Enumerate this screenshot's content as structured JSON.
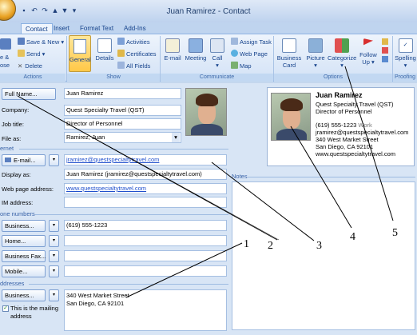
{
  "window": {
    "title": "Juan Ramirez - Contact"
  },
  "qat": {
    "save_icon": "save-icon",
    "undo_icon": "undo-icon",
    "redo_icon": "redo-icon",
    "up_glyph": "▲",
    "down_glyph": "▼",
    "more_glyph": "▾"
  },
  "tabs": [
    {
      "label": "Contact"
    },
    {
      "label": "Insert"
    },
    {
      "label": "Format Text"
    },
    {
      "label": "Add-Ins"
    }
  ],
  "ribbon": {
    "actions": {
      "label": "Actions",
      "save_close_line1": "e &",
      "save_close_line2": "ose",
      "save_new": "Save & New ▾",
      "send": "Send ▾",
      "delete": "Delete"
    },
    "show": {
      "label": "Show",
      "general": "General",
      "details": "Details",
      "activities": "Activities",
      "certificates": "Certificates",
      "all_fields": "All Fields"
    },
    "communicate": {
      "label": "Communicate",
      "email": "E-mail",
      "meeting": "Meeting",
      "call": "Call",
      "call_arrow": "▾",
      "assign_task": "Assign Task",
      "web_page": "Web Page",
      "map": "Map"
    },
    "options": {
      "label": "Options",
      "business_card_1": "Business",
      "business_card_2": "Card",
      "picture": "Picture",
      "picture_arrow": "▾",
      "categorize": "Categorize",
      "categorize_arrow": "▾",
      "follow_up_1": "Follow",
      "follow_up_2": "Up ▾"
    },
    "proofing": {
      "label": "Proofing",
      "spelling": "Spelling",
      "spelling_arrow": "▾"
    }
  },
  "form": {
    "full_name_btn": "Full Name...",
    "full_name": "Juan Ramirez",
    "company_label": "Company:",
    "company": "Quest Specialty Travel (QST)",
    "job_title_label": "Job title:",
    "job_title": "Director of Personnel",
    "file_as_label": "File as:",
    "file_as": "Ramirez, Juan",
    "internet_section": "ernet",
    "email_btn": "E-mail...",
    "email": "jramirez@questspecialtytravel.com",
    "display_as_label": "Display as:",
    "display_as": "Juan Ramirez (jramirez@questspecialtytravel.com)",
    "web_label": "Web page address:",
    "web": "www.questspecialtytravel.com",
    "im_label": "IM address:",
    "im": "",
    "phone_section": "one numbers",
    "business_btn": "Business...",
    "business_phone": "(619) 555-1223",
    "home_btn": "Home...",
    "home_phone": "",
    "fax_btn": "Business Fax...",
    "fax": "",
    "mobile_btn": "Mobile...",
    "mobile": "",
    "addresses_section": "ddresses",
    "address_btn": "Business...",
    "address_line1": "340 West Market Street",
    "address_line2": "San Diego, CA 92101",
    "mailing_check_1": "This is the mailing",
    "mailing_check_2": "address",
    "notes_label": "Notes",
    "dropdown_glyph": "▾"
  },
  "card": {
    "name": "Juan Ramirez",
    "company": "Quest Specialty Travel (QST)",
    "title": "Director of Personnel",
    "phone": "(619) 555-1223",
    "phone_type": "Work",
    "email": "jramirez@questspecialtytravel.com",
    "address1": "340 West Market Street",
    "address2": "San Diego, CA 92101",
    "web": "www.questspecialtytravel.com"
  },
  "callouts": [
    {
      "label": "1"
    },
    {
      "label": "2"
    },
    {
      "label": "3"
    },
    {
      "label": "4"
    },
    {
      "label": "5"
    }
  ],
  "colors": {
    "accent": "#15428b",
    "ribbon_bg": "#d3e2f6",
    "general_active": "#ffc848",
    "link": "#1f4fcc"
  }
}
